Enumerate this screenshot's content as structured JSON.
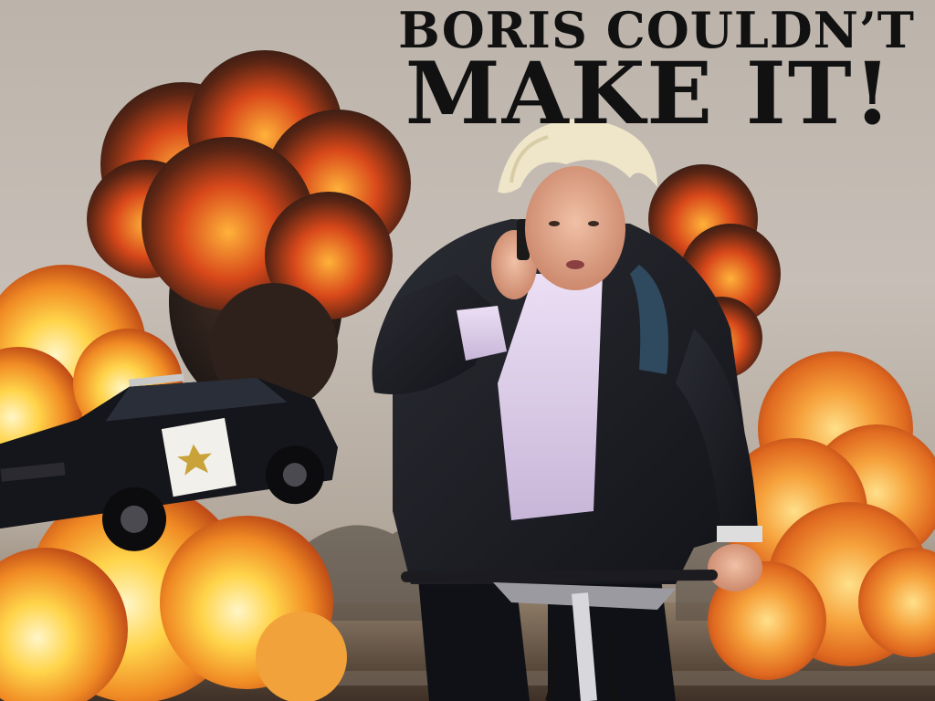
{
  "headline": {
    "line1": "BORIS COULDN’T",
    "line2": "MAKE IT!"
  },
  "scene": {
    "elements": [
      "explosion-fireballs",
      "police-car-airborne",
      "man-on-bicycle-on-phone"
    ],
    "colors": {
      "sky": "#c2b9b0",
      "fire_core": "#ffd24a",
      "fire_outer": "#e0561c",
      "smoke": "#3a2a22",
      "jacket": "#1c1d22",
      "shirt": "#d9c9e6",
      "hair": "#efe6c9"
    }
  }
}
